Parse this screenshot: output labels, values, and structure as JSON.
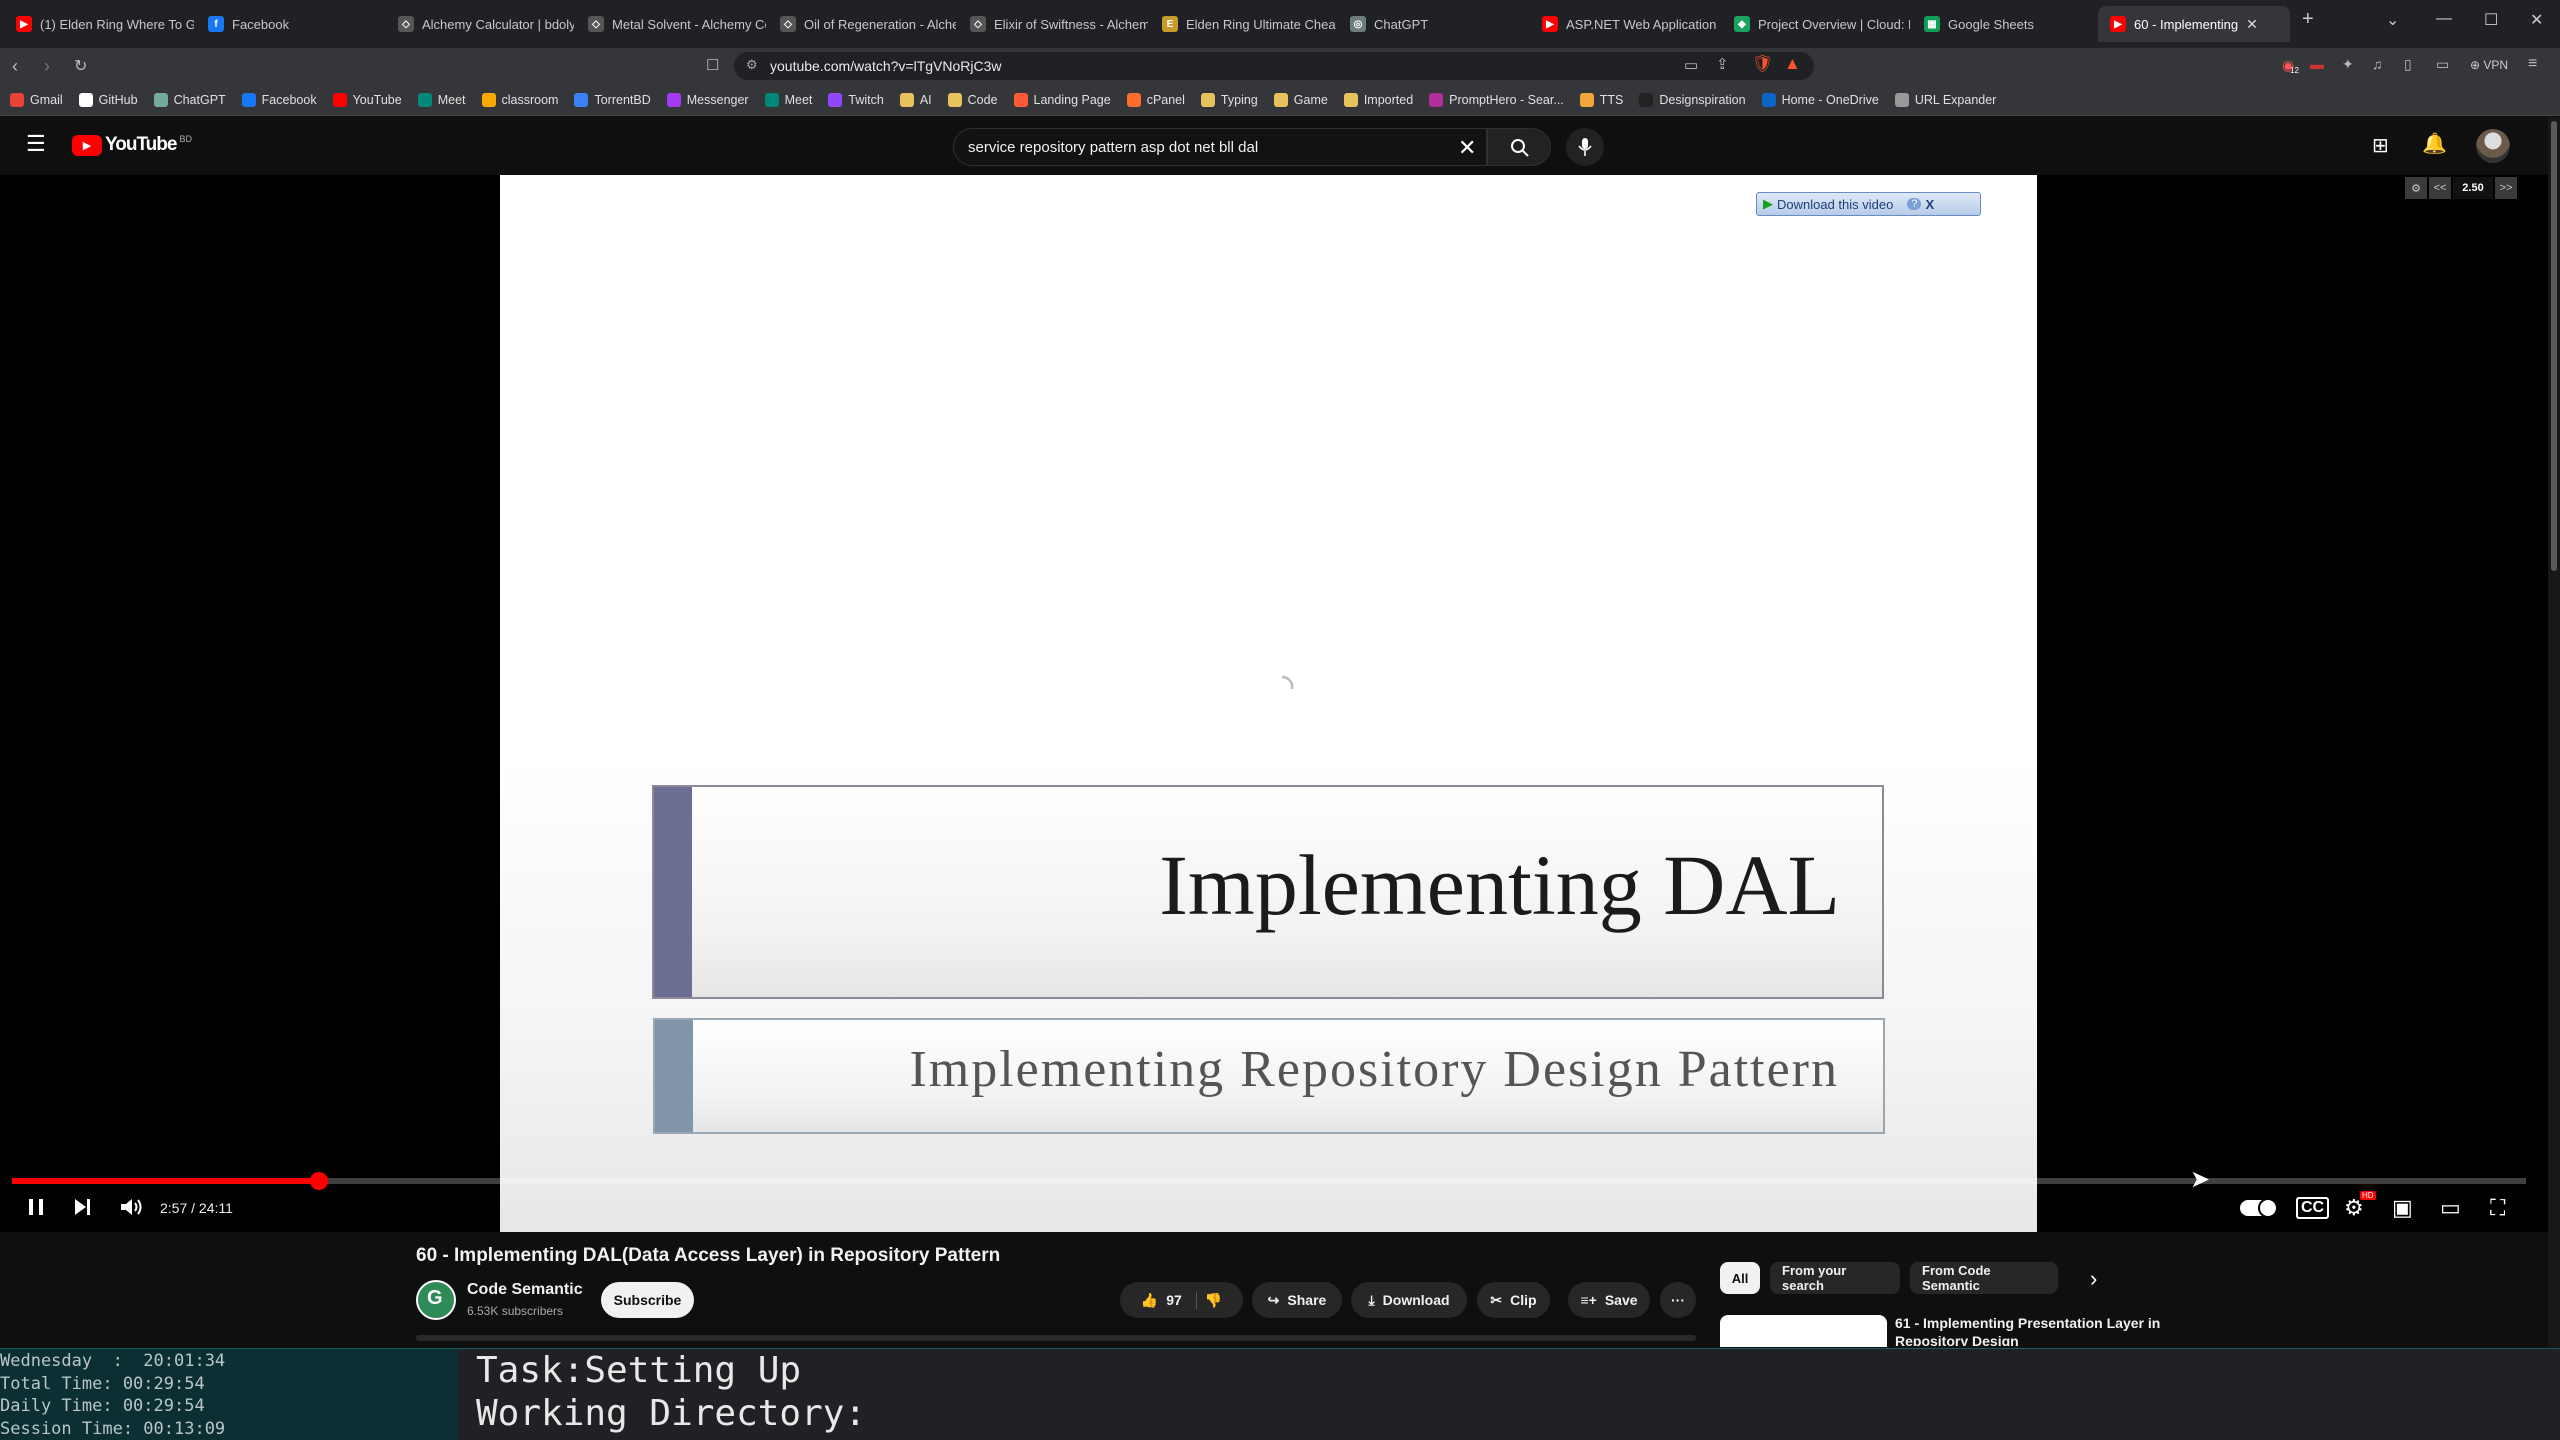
{
  "browser": {
    "tabs": [
      {
        "label": "(1) Elden Ring Where To Go",
        "color": "#ff0000",
        "glyph": "▶"
      },
      {
        "label": "Facebook",
        "color": "#1877f2",
        "glyph": "f"
      },
      {
        "label": "Alchemy Calculator | bdoly",
        "color": "#555555",
        "glyph": "◇"
      },
      {
        "label": "Metal Solvent - Alchemy Co",
        "color": "#555555",
        "glyph": "◇"
      },
      {
        "label": "Oil of Regeneration - Alche",
        "color": "#555555",
        "glyph": "◇"
      },
      {
        "label": "Elixir of Swiftness - Alchem",
        "color": "#555555",
        "glyph": "◇"
      },
      {
        "label": "Elden Ring Ultimate Cheat",
        "color": "#c89b2a",
        "glyph": "E"
      },
      {
        "label": "ChatGPT",
        "color": "#6b7f7a",
        "glyph": "◎"
      },
      {
        "label": "ASP.NET Web Application T",
        "color": "#ff0000",
        "glyph": "▶"
      },
      {
        "label": "Project Overview | Cloud: M",
        "color": "#1aa260",
        "glyph": "◆"
      },
      {
        "label": "Google Sheets",
        "color": "#0f9d58",
        "glyph": "▦"
      },
      {
        "label": "60 - Implementing",
        "color": "#ff0000",
        "glyph": "▶",
        "active": true
      }
    ],
    "new_tab_glyph": "+",
    "url": "youtube.com/watch?v=lTgVNoRjC3w",
    "vpn_label": "VPN",
    "shields_count": "12",
    "bookmarks": [
      {
        "label": "Gmail",
        "color": "#ea4335"
      },
      {
        "label": "GitHub",
        "color": "#ffffff"
      },
      {
        "label": "ChatGPT",
        "color": "#74aa9c"
      },
      {
        "label": "Facebook",
        "color": "#1877f2"
      },
      {
        "label": "YouTube",
        "color": "#ff0000"
      },
      {
        "label": "Meet",
        "color": "#00897b"
      },
      {
        "label": "classroom",
        "color": "#f9ab00"
      },
      {
        "label": "TorrentBD",
        "color": "#3b82f6"
      },
      {
        "label": "Messenger",
        "color": "#a33bf5"
      },
      {
        "label": "Meet",
        "color": "#00897b"
      },
      {
        "label": "Twitch",
        "color": "#9146ff"
      },
      {
        "label": "AI",
        "color": "#e6c15c"
      },
      {
        "label": "Code",
        "color": "#e6c15c"
      },
      {
        "label": "Landing Page",
        "color": "#ff5a36"
      },
      {
        "label": "cPanel",
        "color": "#ff6c2c"
      },
      {
        "label": "Typing",
        "color": "#e6c15c"
      },
      {
        "label": "Game",
        "color": "#e6c15c"
      },
      {
        "label": "Imported",
        "color": "#e6c15c"
      },
      {
        "label": "PromptHero - Sear...",
        "color": "#b0309b"
      },
      {
        "label": "TTS",
        "color": "#f2a53a"
      },
      {
        "label": "Designspiration",
        "color": "#222222"
      },
      {
        "label": "Home - OneDrive",
        "color": "#0a66c2"
      },
      {
        "label": "URL Expander",
        "color": "#999999"
      }
    ]
  },
  "youtube": {
    "logo_text": "YouTube",
    "country_code": "BD",
    "search_query": "service repository pattern asp dot net bll dal",
    "player": {
      "download_label": "Download this video",
      "download_help": "?",
      "download_close": "X",
      "speed_value": "2.50",
      "speed_less": "<<",
      "speed_more": ">>",
      "slide_title": "Implementing DAL",
      "slide_subtitle": "Implementing Repository Design Pattern",
      "current_time": "2:57",
      "duration": "24:11",
      "progress": 0.122,
      "time_display": "2:57 / 24:11",
      "hd_badge": "HD"
    },
    "video_title": "60 - Implementing DAL(Data Access Layer) in Repository Pattern",
    "channel_name": "Code Semantic",
    "channel_subs": "6.53K subscribers",
    "subscribe_label": "Subscribe",
    "like_count": "97",
    "share_label": "Share",
    "download_label": "Download",
    "clip_label": "Clip",
    "save_label": "Save",
    "more_label": "···",
    "chips": [
      "All",
      "From your search",
      "From Code Semantic"
    ],
    "next_video_title": "61 - Implementing Presentation Layer in Repository Design"
  },
  "terminal": {
    "day_line": "Wednesday  :  20:01:34",
    "total_line": "Total Time: 00:29:54",
    "daily_line": "Daily Time: 00:29:54",
    "session_line": "Session Time: 00:13:09",
    "task_line": "Task:Setting Up",
    "dir_line": "Working Directory:"
  },
  "colors": {
    "accent": "#ff0000",
    "yt_bg": "#0f0f0f",
    "slide_accent_1": "#6c6f93",
    "slide_accent_2": "#8396a9"
  }
}
